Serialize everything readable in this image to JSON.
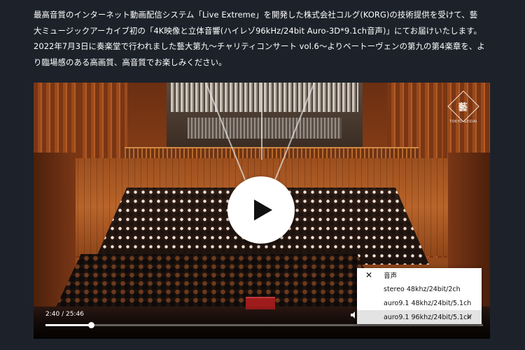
{
  "intro": {
    "line1": "最高音質のインターネット動画配信システム「Live Extreme」を開発した株式会社コルグ(KORG)の技術提供を受けて、藝",
    "line2": "大ミュージックアーカイブ初の「4K映像と立体音響(ハイレゾ96kHz/24bit Auro-3D*9.1ch音声)」にてお届けいたします。",
    "line3": "2022年7月3日に奏楽堂で行われました藝大第九～チャリティコンサート vol.6～よりベートーヴェンの第九の第4楽章を、よ",
    "line4": "り臨場感のある高画質、高音質でお楽しみください。"
  },
  "player": {
    "logo_text": "TOKYO GEIDAI",
    "logo_glyph": "藝",
    "time_display": "2:40 / 25:46",
    "progress_fraction": 0.1035,
    "icons": {
      "play": "play-icon",
      "volume": "volume-icon",
      "close": "close-icon",
      "check": "check-icon"
    },
    "quality_menu": {
      "header": "音声",
      "close_glyph": "✕",
      "check_glyph": "✓",
      "options": [
        {
          "label": "stereo 48khz/24bit/2ch",
          "selected": false
        },
        {
          "label": "auro9.1 48khz/24bit/5.1ch",
          "selected": false
        },
        {
          "label": "auro9.1 96khz/24bit/5.1ch",
          "selected": true
        }
      ]
    }
  },
  "colors": {
    "page_background": "#1d222a",
    "text": "#ffffff",
    "menu_background": "#ffffff",
    "menu_selected": "#e3e3e3"
  }
}
